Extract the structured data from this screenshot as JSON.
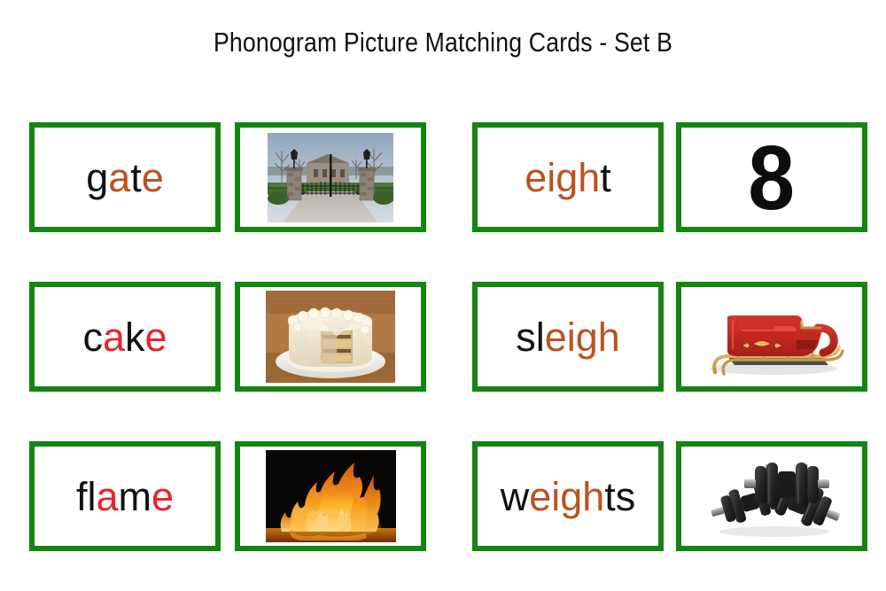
{
  "page": {
    "title": "Phonogram Picture Matching Cards - Set B",
    "background_color": "#ffffff"
  },
  "theme": {
    "card_border_color": "#138510",
    "highlight_orange": "#bd5220",
    "highlight_red": "#e8252a",
    "text_color": "#111111"
  },
  "cards": [
    {
      "id": "word-gate",
      "type": "word",
      "word": "gate",
      "segments": [
        {
          "text": "g",
          "style": "plain"
        },
        {
          "text": "a",
          "style": "hi-orange"
        },
        {
          "text": "t",
          "style": "plain"
        },
        {
          "text": "e",
          "style": "hi-orange"
        }
      ]
    },
    {
      "id": "picture-gate",
      "type": "picture",
      "image_name": "gate-photo",
      "alt": "Iron gate with stone pillars and lamps at the end of a driveway"
    },
    {
      "id": "word-eight",
      "type": "word",
      "word": "eight",
      "segments": [
        {
          "text": "eigh",
          "style": "hi-orange"
        },
        {
          "text": "t",
          "style": "plain"
        }
      ]
    },
    {
      "id": "picture-eight",
      "type": "number",
      "image_name": "numeral-eight",
      "numeral": "8"
    },
    {
      "id": "word-cake",
      "type": "word",
      "word": "cake",
      "segments": [
        {
          "text": "c",
          "style": "plain"
        },
        {
          "text": "a",
          "style": "hi-red"
        },
        {
          "text": "k",
          "style": "plain"
        },
        {
          "text": "e",
          "style": "hi-red"
        }
      ]
    },
    {
      "id": "picture-cake",
      "type": "picture",
      "image_name": "cake-photo",
      "alt": "Layered cake with white frosting on a plate with one slice removed"
    },
    {
      "id": "word-sleigh",
      "type": "word",
      "word": "sleigh",
      "segments": [
        {
          "text": "sl",
          "style": "plain"
        },
        {
          "text": "eigh",
          "style": "hi-orange"
        }
      ]
    },
    {
      "id": "picture-sleigh",
      "type": "picture",
      "image_name": "sleigh-photo",
      "alt": "Red sleigh with gold trim and wooden runners"
    },
    {
      "id": "word-flame",
      "type": "word",
      "word": "flame",
      "segments": [
        {
          "text": "fl",
          "style": "plain"
        },
        {
          "text": "a",
          "style": "hi-red"
        },
        {
          "text": "m",
          "style": "plain"
        },
        {
          "text": "e",
          "style": "hi-red"
        }
      ]
    },
    {
      "id": "picture-flame",
      "type": "picture",
      "image_name": "flame-photo",
      "alt": "Orange flames burning against a black background"
    },
    {
      "id": "word-weights",
      "type": "word",
      "word": "weights",
      "segments": [
        {
          "text": "w",
          "style": "plain"
        },
        {
          "text": "eigh",
          "style": "hi-orange"
        },
        {
          "text": "ts",
          "style": "plain"
        }
      ]
    },
    {
      "id": "picture-weights",
      "type": "picture",
      "image_name": "weights-photo",
      "alt": "Two black dumbbells with weight plates"
    }
  ]
}
